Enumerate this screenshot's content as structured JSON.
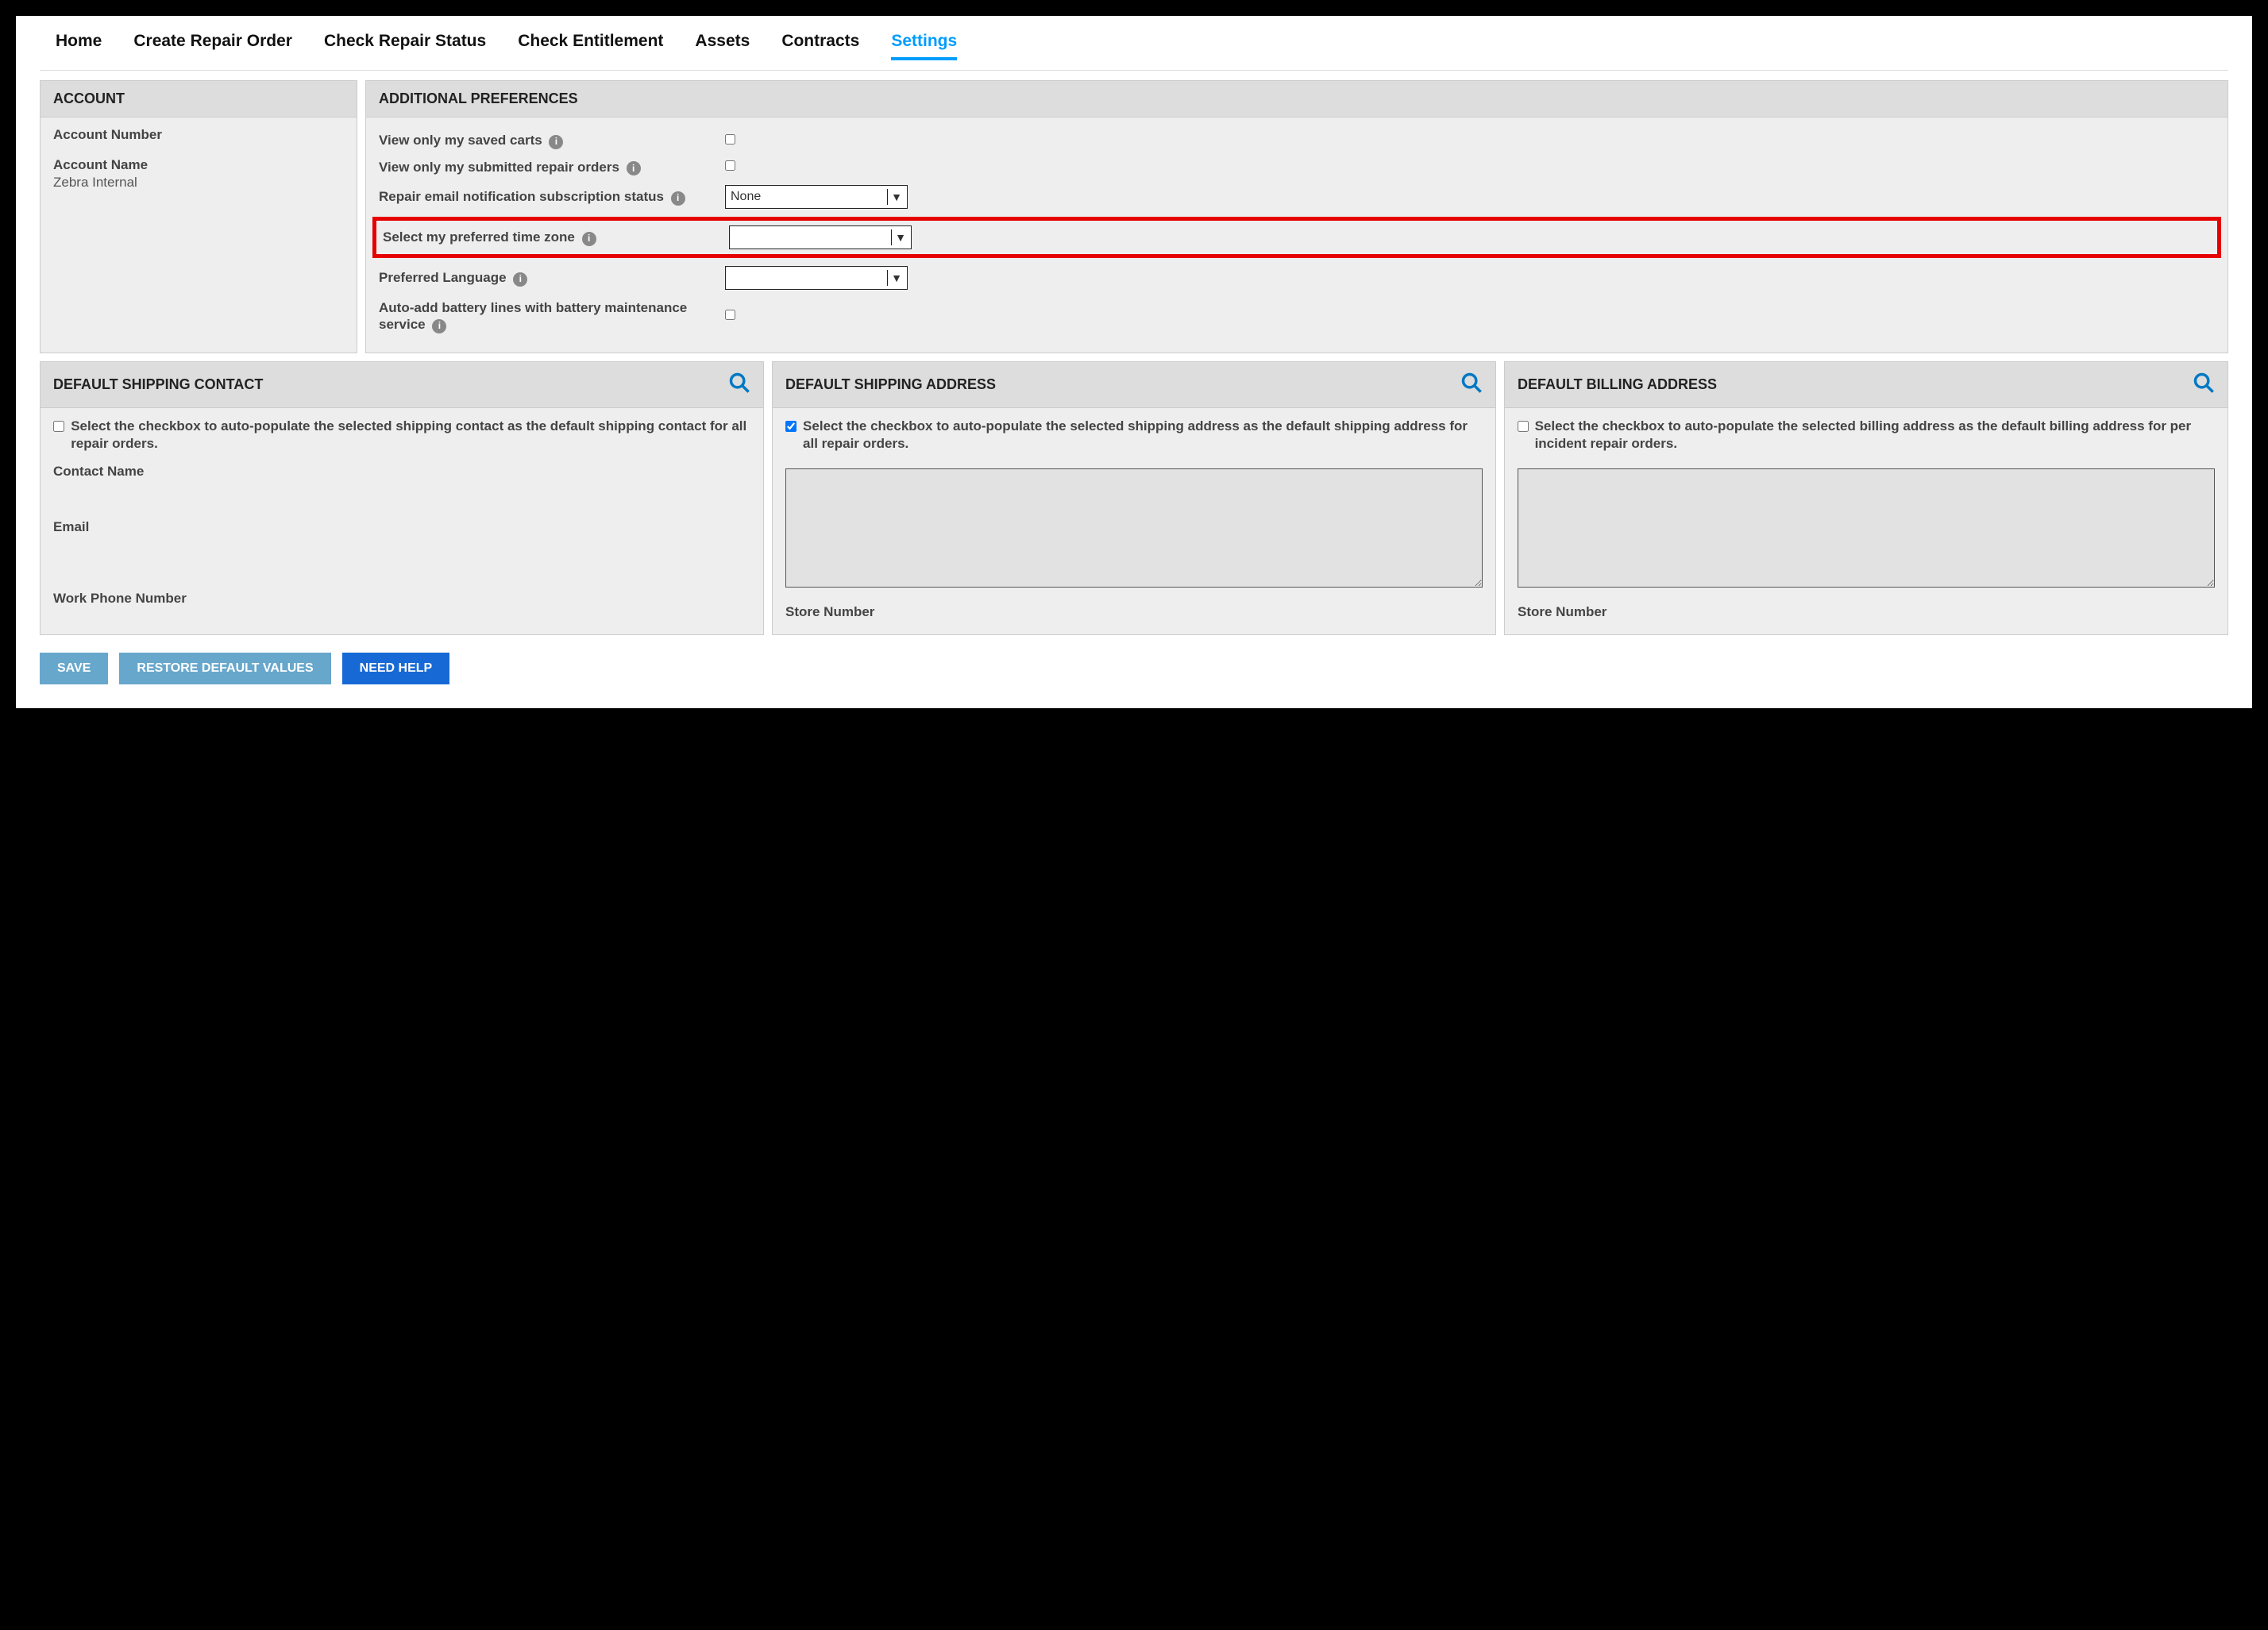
{
  "nav": {
    "home": "Home",
    "create": "Create Repair Order",
    "check_status": "Check Repair Status",
    "check_ent": "Check Entitlement",
    "assets": "Assets",
    "contracts": "Contracts",
    "settings": "Settings"
  },
  "account": {
    "title": "ACCOUNT",
    "number_label": "Account Number",
    "number_value": "",
    "name_label": "Account Name",
    "name_value": "Zebra Internal"
  },
  "prefs": {
    "title": "ADDITIONAL PREFERENCES",
    "saved_carts": "View only my saved carts",
    "submitted_orders": "View only my submitted repair orders",
    "email_sub": "Repair email notification subscription status",
    "email_sub_value": "None",
    "timezone": "Select my preferred time zone",
    "timezone_value": "",
    "language": "Preferred Language",
    "language_value": "",
    "auto_battery": "Auto-add battery lines with battery maintenance service"
  },
  "ship_contact": {
    "title": "DEFAULT SHIPPING CONTACT",
    "checkbox_text": "Select the checkbox to auto-populate the selected shipping contact as the default shipping contact for all repair orders.",
    "name_label": "Contact Name",
    "email_label": "Email",
    "phone_label": "Work Phone Number"
  },
  "ship_addr": {
    "title": "DEFAULT SHIPPING ADDRESS",
    "checkbox_text": "Select the checkbox to auto-populate the selected shipping address as the default shipping address for all repair orders.",
    "store_label": "Store Number"
  },
  "bill_addr": {
    "title": "DEFAULT BILLING ADDRESS",
    "checkbox_text": "Select the checkbox to auto-populate the selected billing address as the default billing address for per incident repair orders.",
    "store_label": "Store Number"
  },
  "buttons": {
    "save": "SAVE",
    "restore": "RESTORE DEFAULT VALUES",
    "help": "NEED HELP"
  }
}
